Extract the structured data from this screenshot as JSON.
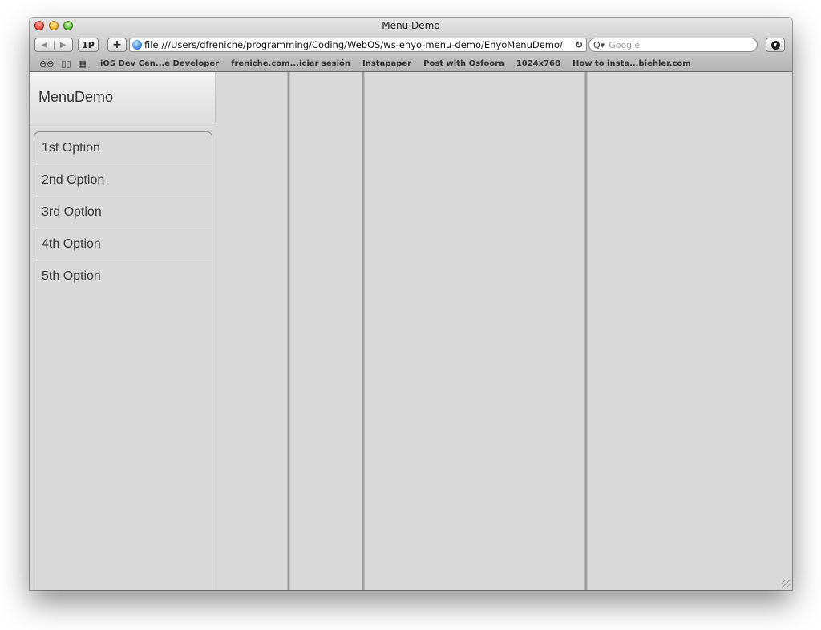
{
  "window": {
    "title": "Menu Demo"
  },
  "toolbar": {
    "back_icon": "back-arrow-icon",
    "forward_icon": "forward-arrow-icon",
    "onepassword_label": "1P",
    "add_label": "+",
    "url": "file:///Users/dfreniche/programming/Coding/WebOS/ws-enyo-menu-demo/EnyoMenuDemo/i",
    "reload_icon": "reload-icon",
    "search_placeholder": "Google",
    "downloads_icon": "download-icon"
  },
  "bookmarks": [
    "iOS Dev Cen...e Developer",
    "freniche.com...iciar sesión",
    "Instapaper",
    "Post with Osfoora",
    "1024x768",
    "How to insta...biehler.com"
  ],
  "app": {
    "header": "MenuDemo",
    "options": [
      "1st Option",
      "2nd Option",
      "3rd Option",
      "4th Option",
      "5th Option"
    ]
  }
}
